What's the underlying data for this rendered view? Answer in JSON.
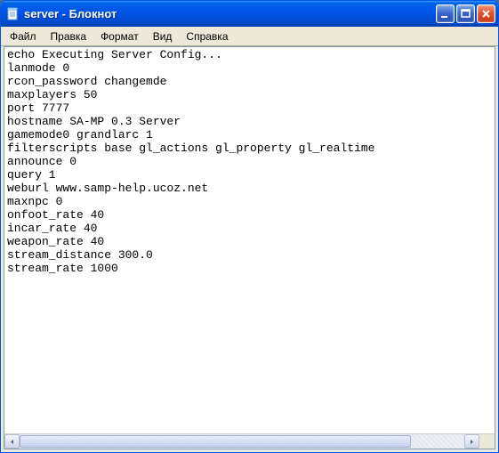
{
  "window": {
    "title": "server - Блокнот"
  },
  "menu": {
    "file": "Файл",
    "edit": "Правка",
    "format": "Формат",
    "view": "Вид",
    "help": "Справка"
  },
  "content": {
    "lines": [
      "echo Executing Server Config...",
      "lanmode 0",
      "rcon_password changemde",
      "maxplayers 50",
      "port 7777",
      "hostname SA-MP 0.3 Server",
      "gamemode0 grandlarc 1",
      "filterscripts base gl_actions gl_property gl_realtime",
      "announce 0",
      "query 1",
      "weburl www.samp-help.ucoz.net",
      "maxnpc 0",
      "onfoot_rate 40",
      "incar_rate 40",
      "weapon_rate 40",
      "stream_distance 300.0",
      "stream_rate 1000"
    ]
  }
}
